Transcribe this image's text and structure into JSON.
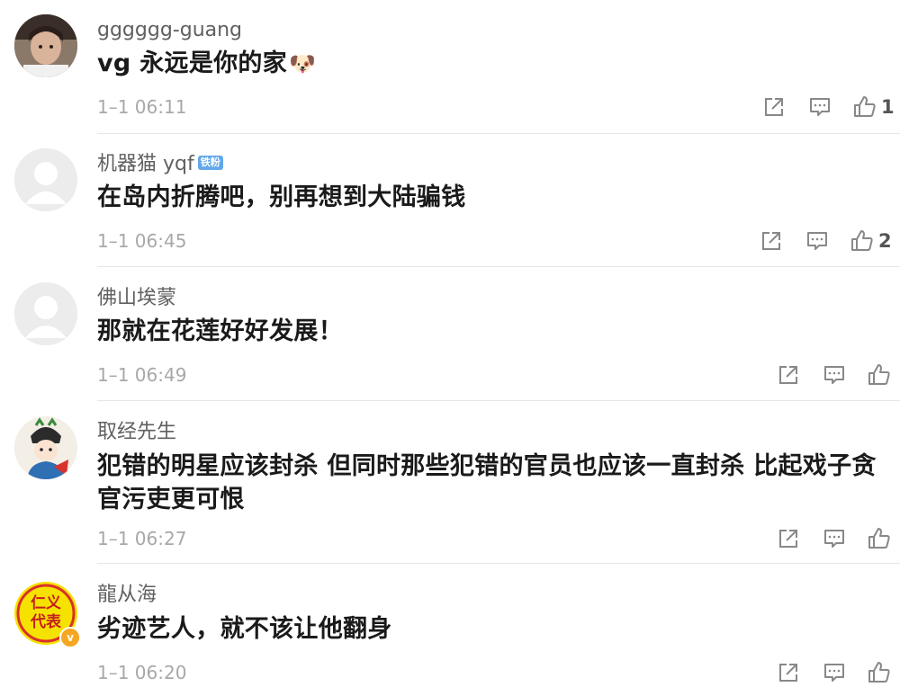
{
  "comments": [
    {
      "username": "gggggg-guang",
      "text": "vg 永远是你的家",
      "emoji": "🐶",
      "time": "1–1 06:11",
      "likes": "1"
    },
    {
      "username": "机器猫 yqf",
      "badge": "铁粉",
      "text": "在岛内折腾吧，别再想到大陆骗钱",
      "time": "1–1 06:45",
      "likes": "2"
    },
    {
      "username": "佛山埃蒙",
      "text": "那就在花莲好好发展！",
      "time": "1–1 06:49",
      "likes": ""
    },
    {
      "username": "取经先生",
      "text": "犯错的明星应该封杀 但同时那些犯错的官员也应该一直封杀 比起戏子贪官污吏更可恨",
      "time": "1–1 06:27",
      "likes": ""
    },
    {
      "username": "龍从海",
      "avatar_text": "仁义代表",
      "text": "劣迹艺人，就不该让他翻身",
      "time": "1–1 06:20",
      "likes": ""
    }
  ],
  "icons": {
    "share": "share-icon",
    "reply": "comment-icon",
    "like": "thumbs-up-icon"
  },
  "colors": {
    "username": "#606060",
    "text": "#1a1a1a",
    "meta": "#a8a8a8",
    "fan_badge": "#62a8ea",
    "verified": "#f5a623"
  }
}
